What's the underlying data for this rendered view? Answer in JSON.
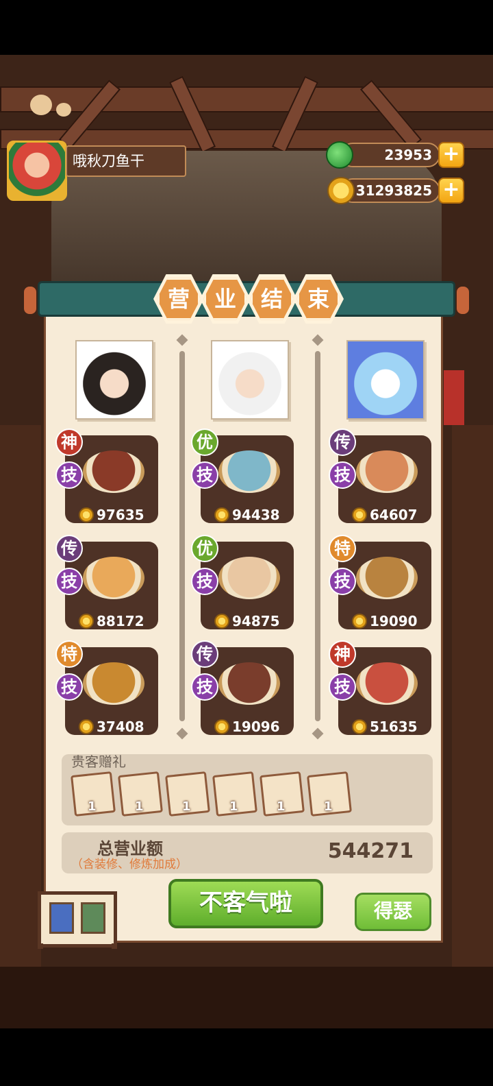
{
  "player": {
    "name": "哦秋刀鱼干"
  },
  "currencies": {
    "jade": {
      "value": "23953",
      "plus": "+"
    },
    "coins": {
      "value": "31293825",
      "plus": "+"
    }
  },
  "title": [
    "营",
    "业",
    "结",
    "束"
  ],
  "colors": {
    "badge_shen": "#c0392b",
    "badge_you": "#6aa82d",
    "badge_chuan": "#6b3d7a",
    "badge_te": "#e08a2c",
    "badge_ji": "#8a3fa8"
  },
  "columns": [
    {
      "dishes": [
        {
          "rank": "神",
          "rank_color": "#c0392b",
          "skill": "技",
          "price": "97635",
          "plate": "#8a3a28"
        },
        {
          "rank": "传",
          "rank_color": "#6b3d7a",
          "skill": "技",
          "price": "88172",
          "plate": "#e9a95a"
        },
        {
          "rank": "特",
          "rank_color": "#e08a2c",
          "skill": "技",
          "price": "37408",
          "plate": "#c98930"
        }
      ]
    },
    {
      "dishes": [
        {
          "rank": "优",
          "rank_color": "#6aa82d",
          "skill": "技",
          "price": "94438",
          "plate": "#7fb7c9"
        },
        {
          "rank": "优",
          "rank_color": "#6aa82d",
          "skill": "技",
          "price": "94875",
          "plate": "#e9c7a2"
        },
        {
          "rank": "传",
          "rank_color": "#6b3d7a",
          "skill": "技",
          "price": "19096",
          "plate": "#7a3d2c"
        }
      ]
    },
    {
      "dishes": [
        {
          "rank": "传",
          "rank_color": "#6b3d7a",
          "skill": "技",
          "price": "64607",
          "plate": "#d98a5a"
        },
        {
          "rank": "特",
          "rank_color": "#e08a2c",
          "skill": "技",
          "price": "19090",
          "plate": "#b9833f"
        },
        {
          "rank": "神",
          "rank_color": "#c0392b",
          "skill": "技",
          "price": "51635",
          "plate": "#c9503f"
        }
      ]
    }
  ],
  "gifts": {
    "label": "贵客赠礼",
    "items": [
      "1",
      "1",
      "1",
      "1",
      "1",
      "1"
    ]
  },
  "total": {
    "label": "总营业额",
    "note": "（含装修、修炼加成）",
    "value": "544271"
  },
  "buttons": {
    "main": "不客气啦",
    "side": "得瑟"
  }
}
